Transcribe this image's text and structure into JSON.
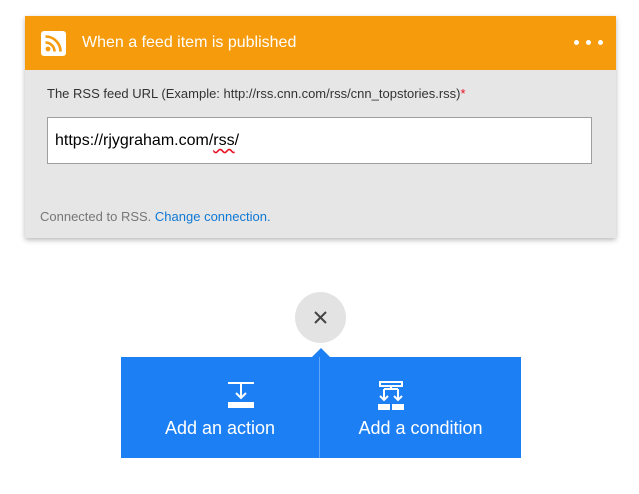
{
  "trigger": {
    "title": "When a feed item is published",
    "icon": "rss-icon",
    "more_icon": "more-options-icon",
    "header_color": "#f59b0c",
    "field_label": "The RSS feed URL (Example: http://rss.cnn.com/rss/cnn_topstories.rss)",
    "required_mark": "*",
    "url_value_prefix": "https://rjygraham.com/",
    "url_value_misspelled": "rss",
    "url_value_suffix": "/",
    "connection_text": "Connected to RSS.",
    "change_connection_label": "Change connection.",
    "link_color": "#0f78d4"
  },
  "close_button": {
    "icon": "close-icon"
  },
  "actions": {
    "accent_color": "#1c7ff3",
    "add_action_label": "Add an action",
    "add_action_icon": "add-action-icon",
    "add_condition_label": "Add a condition",
    "add_condition_icon": "add-condition-icon"
  }
}
